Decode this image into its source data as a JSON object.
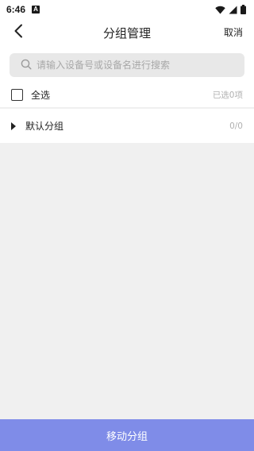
{
  "status_bar": {
    "time": "6:46",
    "notification_icon": "A",
    "icons": [
      "wifi-icon",
      "signal-icon",
      "battery-icon"
    ]
  },
  "header": {
    "back_icon": "chevron-left-icon",
    "title": "分组管理",
    "cancel_label": "取消"
  },
  "search": {
    "placeholder": "请输入设备号或设备名进行搜索",
    "value": "",
    "icon": "search-icon"
  },
  "select_all": {
    "label": "全选",
    "selected_text": "已选0项",
    "checked": false
  },
  "groups": [
    {
      "name": "默认分组",
      "count_text": "0/0",
      "expanded": false,
      "icon": "triangle-right-icon"
    }
  ],
  "footer": {
    "move_label": "移动分组"
  },
  "colors": {
    "accent": "#7f8ce8",
    "background": "#f0f0f0",
    "search_bg": "#e8e8e8",
    "muted_text": "#b0b0b0"
  }
}
